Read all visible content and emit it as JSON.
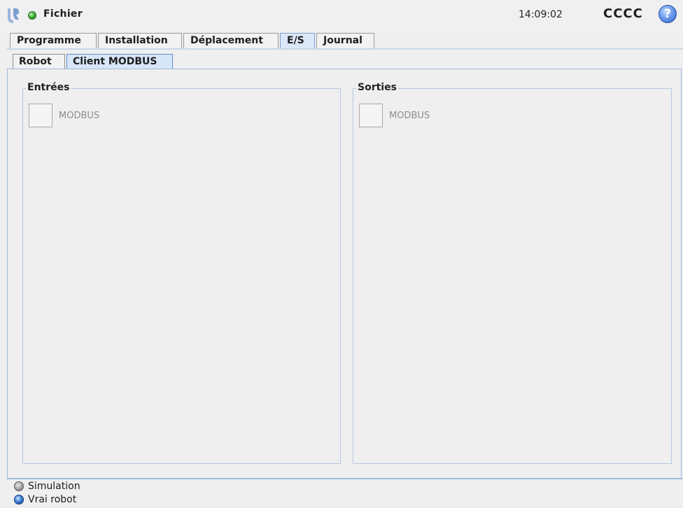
{
  "header": {
    "file_menu": "Fichier",
    "clock": "14:09:02",
    "robot_name": "CCCC",
    "help_glyph": "?",
    "status_color": "#3fb43a"
  },
  "main_tabs": [
    {
      "label": "Programme",
      "active": false
    },
    {
      "label": "Installation",
      "active": false
    },
    {
      "label": "Déplacement",
      "active": false
    },
    {
      "label": "E/S",
      "active": true
    },
    {
      "label": "Journal",
      "active": false
    }
  ],
  "sub_tabs": [
    {
      "label": "Robot",
      "active": false
    },
    {
      "label": "Client MODBUS",
      "active": true
    }
  ],
  "inputs_group": {
    "title": "Entrées",
    "items": [
      {
        "label": "MODBUS",
        "checked": false
      }
    ]
  },
  "outputs_group": {
    "title": "Sorties",
    "items": [
      {
        "label": "MODBUS",
        "checked": false
      }
    ]
  },
  "mode": {
    "simulation": "Simulation",
    "real_robot": "Vrai robot",
    "selected": "real_robot"
  },
  "icons": {
    "logo": "ur-logo-icon",
    "status": "status-dot-icon",
    "help": "help-icon"
  }
}
